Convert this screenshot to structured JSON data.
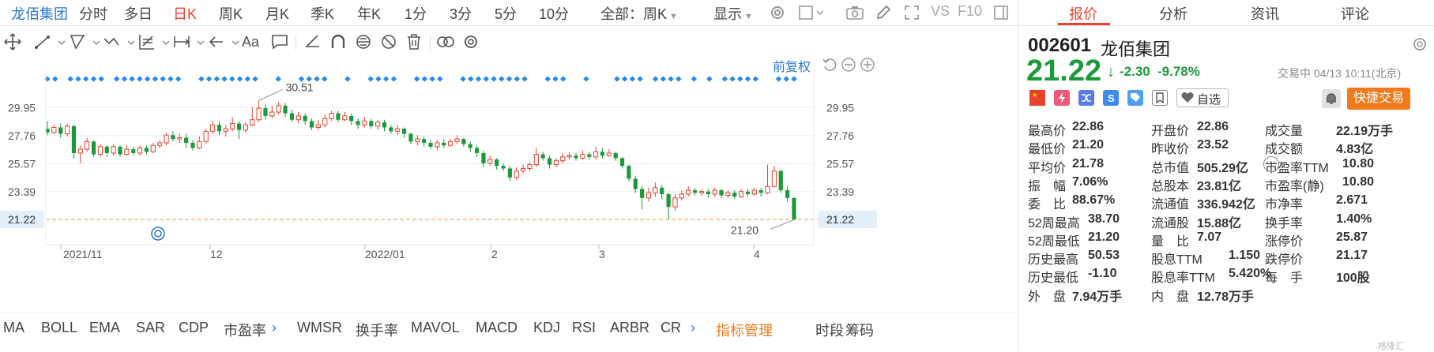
{
  "tabs": {
    "stock_name": "龙佰集团",
    "items": [
      "分时",
      "多日",
      "日K",
      "周K",
      "月K",
      "季K",
      "年K",
      "1分",
      "3分",
      "5分",
      "10分"
    ],
    "active": "日K",
    "range_select": "全部：周K",
    "display": "显示",
    "vs": "VS",
    "f10": "F10"
  },
  "chart_header": {
    "adjust": "前复权"
  },
  "chart_data": {
    "type": "candlestick",
    "y_ticks": [
      "29.95",
      "27.76",
      "25.57",
      "23.39",
      "21.22"
    ],
    "x_labels": [
      "2021/11",
      "12",
      "2022/01",
      "2",
      "3",
      "4"
    ],
    "high_annotation": "30.51",
    "low_annotation": "21.20",
    "current_price_label": "21.22",
    "ylim": [
      19.5,
      31.2
    ],
    "candles": [
      [
        28.3,
        28.0,
        28.9,
        27.8
      ],
      [
        28.0,
        28.4,
        28.6,
        27.9
      ],
      [
        28.4,
        27.9,
        28.7,
        27.6
      ],
      [
        27.9,
        28.5,
        28.7,
        27.7
      ],
      [
        28.5,
        26.4,
        28.6,
        26.0
      ],
      [
        26.4,
        26.7,
        27.0,
        25.6
      ],
      [
        26.7,
        27.3,
        27.6,
        26.5
      ],
      [
        27.3,
        26.3,
        27.4,
        26.1
      ],
      [
        26.3,
        26.9,
        27.1,
        26.1
      ],
      [
        26.9,
        26.4,
        27.0,
        26.1
      ],
      [
        26.4,
        26.9,
        27.1,
        26.2
      ],
      [
        26.9,
        26.3,
        27.0,
        26.1
      ],
      [
        26.3,
        26.7,
        27.0,
        26.2
      ],
      [
        26.7,
        26.4,
        26.9,
        26.2
      ],
      [
        26.4,
        26.8,
        27.0,
        26.2
      ],
      [
        26.8,
        26.5,
        27.0,
        26.3
      ],
      [
        26.5,
        27.0,
        27.2,
        26.4
      ],
      [
        27.0,
        27.2,
        27.4,
        26.8
      ],
      [
        27.2,
        27.8,
        28.0,
        27.0
      ],
      [
        27.8,
        27.5,
        28.1,
        27.3
      ],
      [
        27.5,
        27.6,
        27.9,
        27.2
      ],
      [
        27.6,
        27.2,
        27.9,
        26.8
      ],
      [
        27.2,
        26.8,
        27.4,
        26.6
      ],
      [
        26.8,
        27.3,
        27.7,
        26.7
      ],
      [
        27.3,
        28.1,
        28.3,
        27.1
      ],
      [
        28.1,
        28.6,
        28.9,
        27.9
      ],
      [
        28.6,
        28.1,
        28.9,
        27.8
      ],
      [
        28.1,
        28.3,
        28.6,
        27.7
      ],
      [
        28.3,
        28.7,
        29.2,
        28.1
      ],
      [
        28.7,
        28.2,
        28.9,
        27.5
      ],
      [
        28.2,
        28.6,
        28.8,
        28.0
      ],
      [
        28.6,
        29.0,
        30.0,
        28.5
      ],
      [
        29.0,
        29.9,
        30.5,
        28.8
      ],
      [
        29.9,
        29.3,
        30.2,
        29.0
      ],
      [
        29.3,
        29.6,
        30.1,
        29.1
      ],
      [
        29.6,
        30.1,
        30.4,
        29.4
      ],
      [
        30.1,
        29.5,
        30.3,
        29.2
      ],
      [
        29.5,
        29.0,
        29.8,
        28.8
      ],
      [
        29.0,
        29.3,
        29.6,
        28.7
      ],
      [
        29.3,
        28.9,
        29.5,
        28.6
      ],
      [
        28.9,
        28.4,
        29.1,
        28.2
      ],
      [
        28.4,
        28.6,
        29.0,
        28.2
      ],
      [
        28.6,
        29.1,
        29.4,
        28.4
      ],
      [
        29.1,
        29.5,
        29.7,
        28.9
      ],
      [
        29.5,
        29.0,
        29.7,
        28.8
      ],
      [
        29.0,
        29.3,
        29.6,
        28.9
      ],
      [
        29.3,
        28.9,
        29.5,
        28.6
      ],
      [
        28.9,
        28.6,
        29.1,
        28.3
      ],
      [
        28.6,
        28.9,
        29.2,
        28.4
      ],
      [
        28.9,
        28.5,
        29.1,
        28.3
      ],
      [
        28.5,
        28.8,
        29.0,
        28.2
      ],
      [
        28.8,
        28.4,
        29.0,
        28.1
      ],
      [
        28.4,
        28.1,
        28.6,
        27.9
      ],
      [
        28.1,
        28.3,
        28.6,
        27.8
      ],
      [
        28.3,
        27.9,
        28.4,
        27.6
      ],
      [
        27.9,
        27.3,
        28.0,
        27.1
      ],
      [
        27.3,
        27.5,
        27.8,
        27.0
      ],
      [
        27.5,
        27.2,
        27.7,
        26.9
      ],
      [
        27.2,
        26.9,
        27.4,
        26.7
      ],
      [
        26.9,
        27.2,
        27.4,
        26.6
      ],
      [
        27.2,
        27.0,
        27.5,
        26.8
      ],
      [
        27.0,
        27.3,
        27.5,
        26.9
      ],
      [
        27.3,
        27.5,
        27.8,
        27.1
      ],
      [
        27.5,
        27.1,
        27.6,
        26.9
      ],
      [
        27.1,
        26.8,
        27.3,
        26.5
      ],
      [
        26.8,
        26.4,
        27.0,
        26.1
      ],
      [
        26.4,
        25.6,
        26.6,
        25.3
      ],
      [
        25.6,
        25.9,
        26.2,
        25.4
      ],
      [
        25.9,
        25.4,
        26.0,
        25.1
      ],
      [
        25.4,
        25.2,
        25.6,
        25.0
      ],
      [
        25.2,
        24.5,
        25.4,
        24.2
      ],
      [
        24.5,
        25.0,
        25.3,
        24.3
      ],
      [
        25.0,
        25.2,
        25.5,
        24.8
      ],
      [
        25.2,
        25.5,
        25.7,
        25.0
      ],
      [
        25.5,
        26.3,
        26.8,
        25.3
      ],
      [
        26.3,
        26.0,
        26.5,
        25.8
      ],
      [
        26.0,
        25.5,
        26.2,
        25.2
      ],
      [
        25.5,
        25.8,
        26.0,
        25.3
      ],
      [
        25.8,
        26.1,
        26.4,
        25.6
      ],
      [
        26.1,
        26.2,
        26.5,
        25.9
      ],
      [
        26.2,
        26.0,
        26.4,
        25.8
      ],
      [
        26.0,
        26.3,
        26.6,
        25.9
      ],
      [
        26.3,
        26.1,
        26.5,
        25.9
      ],
      [
        26.1,
        26.5,
        26.9,
        25.9
      ],
      [
        26.5,
        26.2,
        26.8,
        26.0
      ],
      [
        26.2,
        26.4,
        26.7,
        26.1
      ],
      [
        26.4,
        26.0,
        26.5,
        25.8
      ],
      [
        26.0,
        25.4,
        26.1,
        25.2
      ],
      [
        25.4,
        24.4,
        25.5,
        24.2
      ],
      [
        24.4,
        23.6,
        24.6,
        23.3
      ],
      [
        23.6,
        22.9,
        23.8,
        22.0
      ],
      [
        22.9,
        23.3,
        23.7,
        22.6
      ],
      [
        23.3,
        23.7,
        24.1,
        23.0
      ],
      [
        23.7,
        23.2,
        23.9,
        22.8
      ],
      [
        23.2,
        22.2,
        23.3,
        21.2
      ],
      [
        22.2,
        22.9,
        23.2,
        21.9
      ],
      [
        22.9,
        23.2,
        23.5,
        22.7
      ],
      [
        23.2,
        23.5,
        23.8,
        23.0
      ],
      [
        23.5,
        23.3,
        23.7,
        23.1
      ],
      [
        23.3,
        23.4,
        23.6,
        23.1
      ],
      [
        23.4,
        23.2,
        23.6,
        22.9
      ],
      [
        23.2,
        23.5,
        23.7,
        23.0
      ],
      [
        23.5,
        23.1,
        23.6,
        22.9
      ],
      [
        23.1,
        23.3,
        23.5,
        22.9
      ],
      [
        23.3,
        23.0,
        23.5,
        22.8
      ],
      [
        23.0,
        23.4,
        23.6,
        22.9
      ],
      [
        23.4,
        23.2,
        23.6,
        23.0
      ],
      [
        23.2,
        23.5,
        23.7,
        23.1
      ],
      [
        23.5,
        23.3,
        23.7,
        23.0
      ],
      [
        23.3,
        23.8,
        25.5,
        23.2
      ],
      [
        23.8,
        25.0,
        25.4,
        23.7
      ],
      [
        25.0,
        23.5,
        25.1,
        23.3
      ],
      [
        23.5,
        22.9,
        23.8,
        22.6
      ],
      [
        22.9,
        21.2,
        22.9,
        21.2
      ]
    ],
    "markers": "++.+++++.+++++++++..++++++++..+..++++..+..++++..++++..+++++++++..+++..+...++++.++++.+.+.+++++..+++"
  },
  "indicators": {
    "items": [
      "MA",
      "BOLL",
      "EMA",
      "SAR",
      "CDP",
      "市盈率",
      "WMSR",
      "换手率",
      "MAVOL",
      "MACD",
      "KDJ",
      "RSI",
      "ARBR",
      "CR"
    ],
    "manage": "指标管理",
    "timeshare": "时段",
    "chips": "筹码"
  },
  "quote_tabs": [
    "报价",
    "分析",
    "资讯",
    "评论"
  ],
  "quote": {
    "code": "002601",
    "name": "龙佰集团",
    "price": "21.22",
    "change": "-2.30",
    "change_pct": "-9.78%",
    "status": "交易中 04/13 10:11(北京)",
    "watchlist": "自选",
    "trade_button": "快捷交易",
    "colors": {
      "up": "#e8422d",
      "down": "#1a9a3a",
      "accent": "#f07b1d"
    }
  },
  "fields": [
    {
      "label": "最高价",
      "value": "22.86",
      "color": "green"
    },
    {
      "label": "开盘价",
      "value": "22.86",
      "color": "green"
    },
    {
      "label": "成交量",
      "value": "22.19万手",
      "color": "dark"
    },
    {
      "label": "最低价",
      "value": "21.20",
      "color": "green"
    },
    {
      "label": "昨收价",
      "value": "23.52",
      "color": "dark"
    },
    {
      "label": "成交额",
      "value": "4.83亿",
      "color": "dark"
    },
    {
      "label": "平均价",
      "value": "21.78",
      "color": "green"
    },
    {
      "label": "总市值",
      "value": "505.29亿",
      "color": "dark"
    },
    {
      "label": "市盈率TTM",
      "value": "10.80",
      "color": "dark"
    },
    {
      "label": "振　幅",
      "value": "7.06%",
      "color": "dark"
    },
    {
      "label": "总股本",
      "value": "23.81亿",
      "color": "dark"
    },
    {
      "label": "市盈率(静)",
      "value": "10.80",
      "color": "dark"
    },
    {
      "label": "委　比",
      "value": "88.67%",
      "color": "dark"
    },
    {
      "label": "流通值",
      "value": "336.942亿",
      "color": "dark"
    },
    {
      "label": "市净率",
      "value": "2.671",
      "color": "dark"
    },
    {
      "label": "52周最高",
      "value": "38.70",
      "color": "red"
    },
    {
      "label": "流通股",
      "value": "15.88亿",
      "color": "dark"
    },
    {
      "label": "换手率",
      "value": "1.40%",
      "color": "dark"
    },
    {
      "label": "52周最低",
      "value": "21.20",
      "color": "green"
    },
    {
      "label": "量　比",
      "value": "7.07",
      "color": "dark"
    },
    {
      "label": "涨停价",
      "value": "25.87",
      "color": "red"
    },
    {
      "label": "历史最高",
      "value": "50.53",
      "color": "red"
    },
    {
      "label": "股息TTM",
      "value": "1.150",
      "color": "dark"
    },
    {
      "label": "跌停价",
      "value": "21.17",
      "color": "green"
    },
    {
      "label": "历史最低",
      "value": "-1.10",
      "color": "green"
    },
    {
      "label": "股息率TTM",
      "value": "5.420%",
      "color": "dark"
    },
    {
      "label": "每　手",
      "value": "100股",
      "color": "dark"
    },
    {
      "label": "外　盘",
      "value": "7.94万手",
      "color": "red"
    },
    {
      "label": "内　盘",
      "value": "12.78万手",
      "color": "green"
    },
    {
      "label": "",
      "value": "",
      "color": "dark"
    }
  ]
}
